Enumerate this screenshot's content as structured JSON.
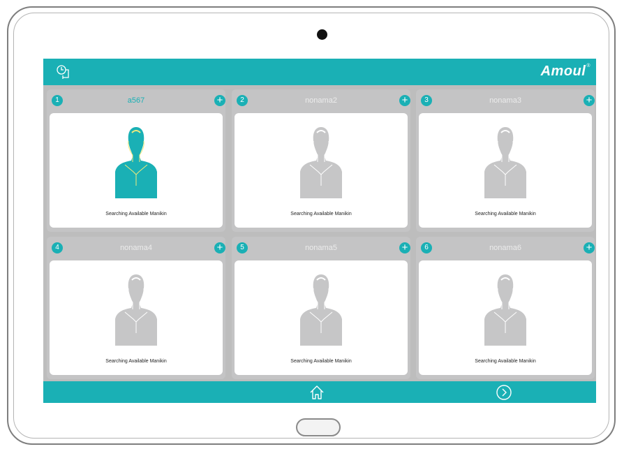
{
  "app": {
    "brand": "Amoul",
    "trademark": "®"
  },
  "colors": {
    "accent": "#1ab0b5",
    "panel": "#c4c4c5",
    "inactive_figure": "#c6c6c7"
  },
  "icons": {
    "timer": "timer-icon",
    "add": "plus-circle-icon",
    "home": "home-icon",
    "next": "chevron-right-circle-icon"
  },
  "cards": [
    {
      "number": "1",
      "name": "a567",
      "status": "Searching Available Manikin",
      "active": true
    },
    {
      "number": "2",
      "name": "nonama2",
      "status": "Searching Available Manikin",
      "active": false
    },
    {
      "number": "3",
      "name": "nonama3",
      "status": "Searching Available Manikin",
      "active": false
    },
    {
      "number": "4",
      "name": "nonama4",
      "status": "Searching Available Manikin",
      "active": false
    },
    {
      "number": "5",
      "name": "nonama5",
      "status": "Searching Available Manikin",
      "active": false
    },
    {
      "number": "6",
      "name": "nonama6",
      "status": "Searching Available Manikin",
      "active": false
    }
  ]
}
